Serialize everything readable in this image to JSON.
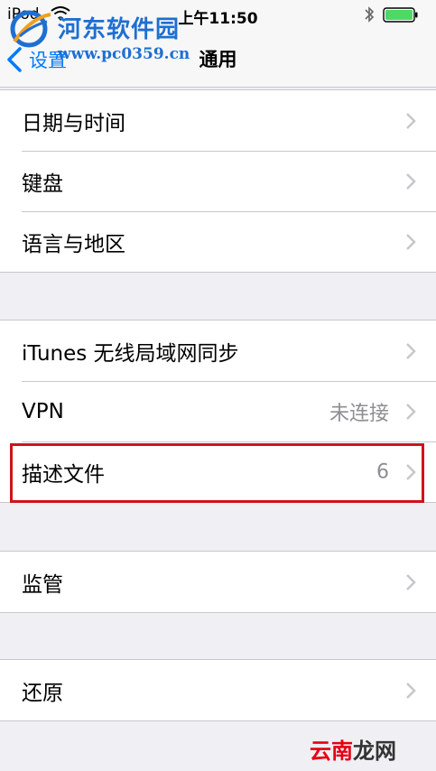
{
  "status_bar": {
    "carrier": "iPod",
    "time": "上午11:50",
    "icons": [
      "wifi-icon",
      "bluetooth-icon",
      "battery-icon"
    ]
  },
  "nav": {
    "back_label": "设置",
    "title": "通用"
  },
  "groups": [
    {
      "items": [
        {
          "label": "日期与时间",
          "detail": ""
        },
        {
          "label": "键盘",
          "detail": ""
        },
        {
          "label": "语言与地区",
          "detail": ""
        }
      ]
    },
    {
      "items": [
        {
          "label": "iTunes 无线局域网同步",
          "detail": ""
        },
        {
          "label": "VPN",
          "detail": "未连接"
        },
        {
          "label": "描述文件",
          "detail": "6"
        }
      ]
    },
    {
      "items": [
        {
          "label": "监管",
          "detail": ""
        }
      ]
    },
    {
      "items": [
        {
          "label": "还原",
          "detail": ""
        }
      ]
    }
  ],
  "watermarks": {
    "top_title": "河东软件园",
    "top_url": "www.pc0359.cn",
    "bottom_part1": "云南",
    "bottom_part2": "龙网"
  },
  "colors": {
    "accent": "#007aff",
    "highlight": "#d0121b",
    "background": "#efeff4"
  }
}
